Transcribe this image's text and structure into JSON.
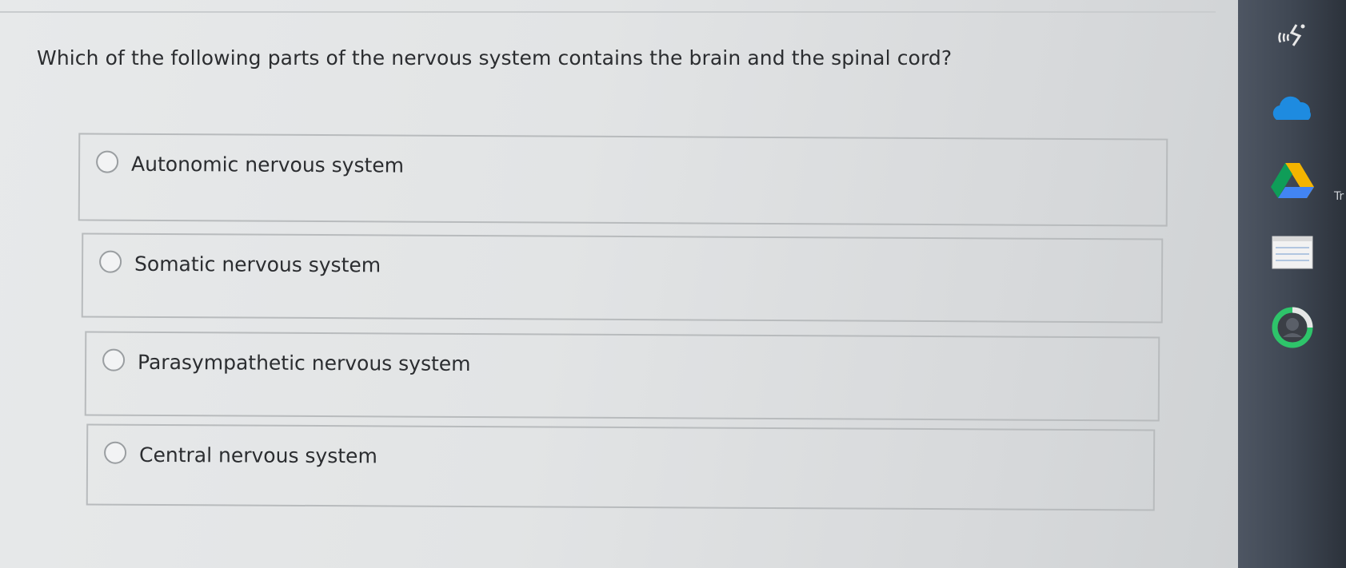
{
  "question": {
    "text": "Which of the following parts of the nervous system contains the brain and the spinal cord?"
  },
  "options": [
    {
      "label": "Autonomic nervous system",
      "selected": false
    },
    {
      "label": "Somatic nervous system",
      "selected": false
    },
    {
      "label": "Parasympathetic nervous system",
      "selected": false
    },
    {
      "label": "Central nervous system",
      "selected": false
    }
  ],
  "taskbar": {
    "icons": [
      "network-activity-icon",
      "onedrive-cloud-icon",
      "google-drive-icon",
      "notepad-icon",
      "update-ring-icon"
    ],
    "edge_text": "Tr"
  }
}
